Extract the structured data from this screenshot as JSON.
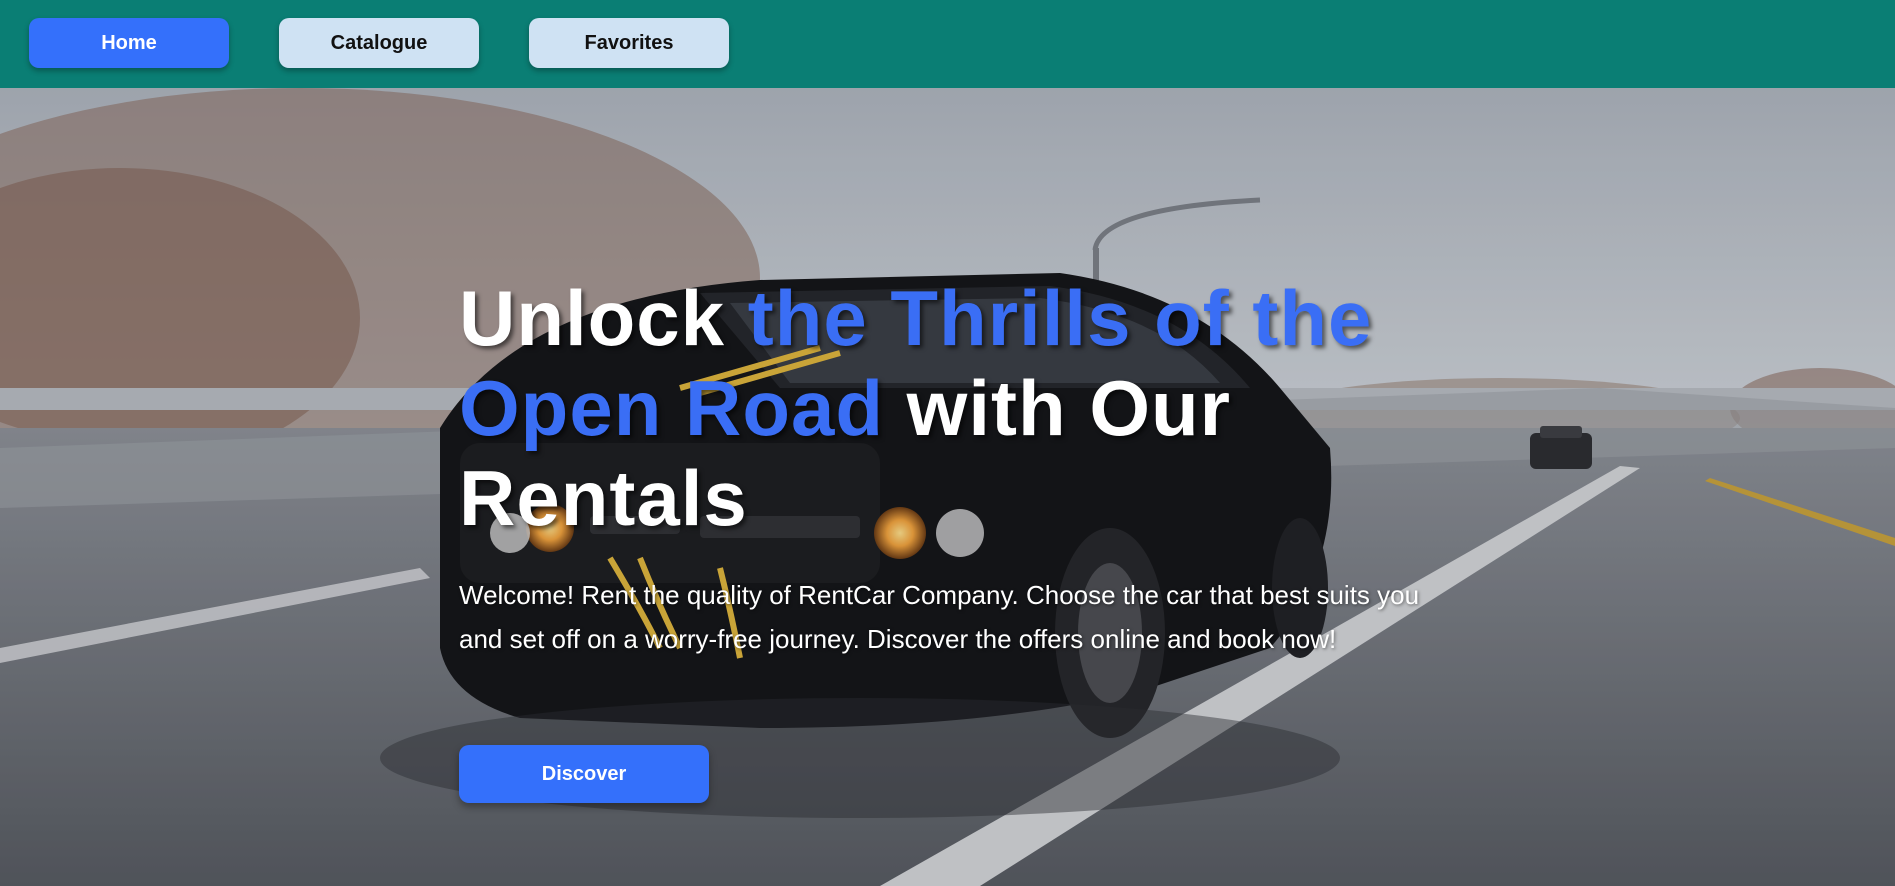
{
  "nav": {
    "home_label": "Home",
    "catalogue_label": "Catalogue",
    "favorites_label": "Favorites"
  },
  "hero": {
    "title_part1": "Unlock ",
    "title_accent": "the Thrills of the Open Road",
    "title_part2": " with Our Rentals",
    "description": "Welcome! Rent the quality of RentCar Company. Choose the car that best suits you and set off on a worry-free journey. Discover the offers online and book now!",
    "discover_label": "Discover"
  },
  "colors": {
    "navbar_bg": "#0a7e74",
    "primary_button": "#3470fb",
    "secondary_button": "#cfe2f3",
    "title_accent": "#3a6ef5"
  }
}
